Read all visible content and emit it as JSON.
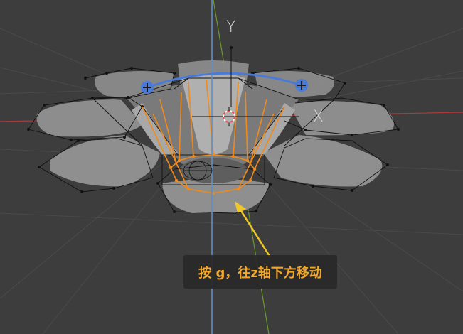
{
  "viewport": {
    "background": "#3d3d3d",
    "grid_color": "#4a4a4a",
    "x_axis_color": "#b03a3a",
    "y_axis_color": "#6a9a2a",
    "z_axis_color": "#5a8fd0",
    "selection_color": "#f08a1a",
    "handle_color": "#4a7ad8",
    "wire_color": "#111111",
    "surface_color": "#8a8a8a"
  },
  "gizmo": {
    "y_label": "Y",
    "x_label": "X"
  },
  "annotation": {
    "text": "按 g，往z轴下方移动",
    "color": "#f0a72a"
  },
  "icons": [
    "plus-handle-icon",
    "cursor-3d-icon",
    "arrow-pointer-icon"
  ]
}
